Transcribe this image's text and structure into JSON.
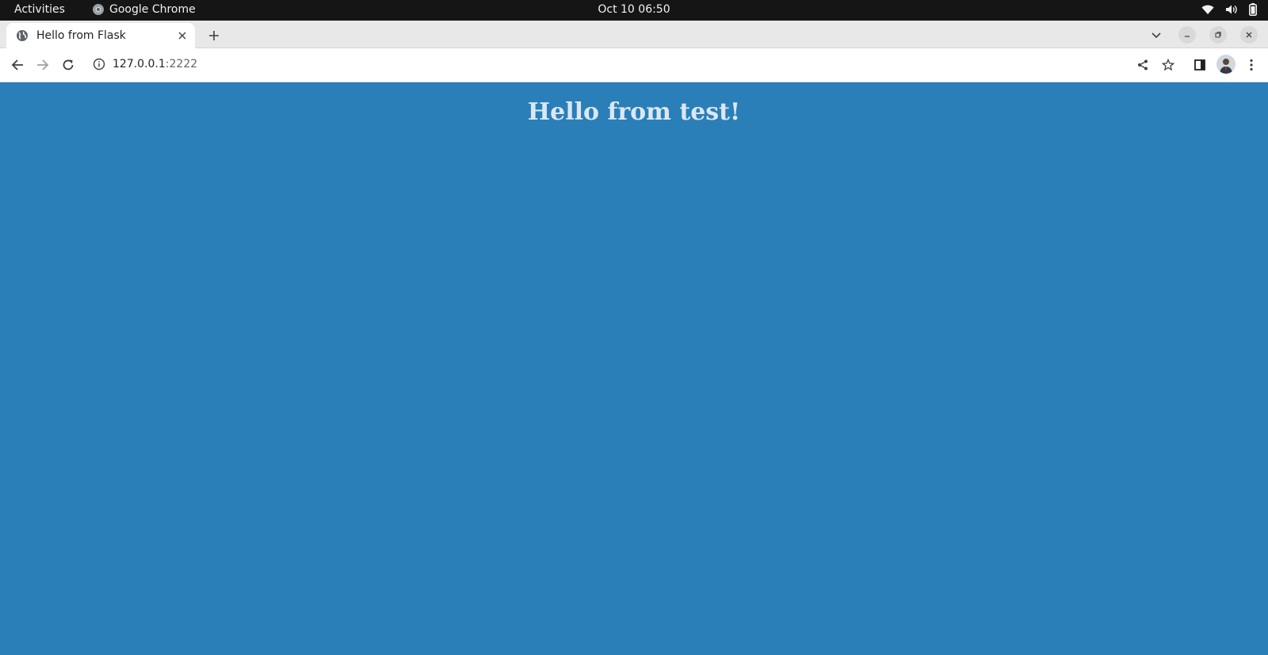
{
  "system_bar": {
    "activities_label": "Activities",
    "app_name": "Google Chrome",
    "datetime": "Oct 10  06:50",
    "tray_icons": [
      "wifi-icon",
      "volume-icon",
      "battery-icon"
    ]
  },
  "browser": {
    "tab": {
      "title": "Hello from Flask",
      "favicon": "globe-icon"
    },
    "address": {
      "host": "127.0.0.1",
      "port": ":2222"
    }
  },
  "page": {
    "heading": "Hello from test!",
    "background_color": "#2a7fb8",
    "heading_color": "#dbe7f2"
  }
}
